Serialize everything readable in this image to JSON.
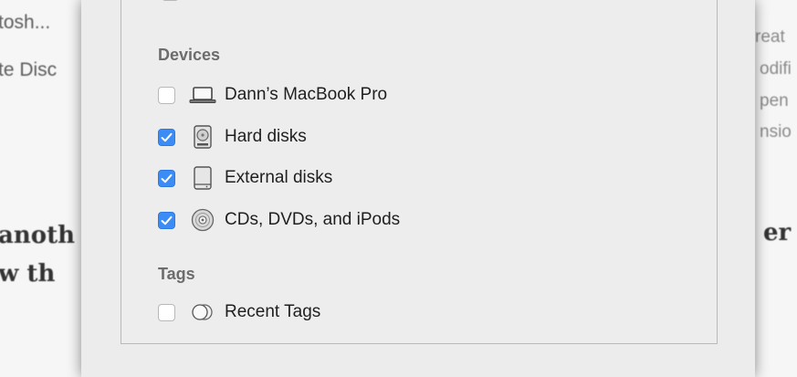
{
  "background": {
    "left_lines": [
      "tosh...",
      "te Disc",
      "anoth",
      "w th"
    ],
    "right_lines": [
      "reat",
      "odifi",
      "pen",
      "nsio",
      "er"
    ]
  },
  "sidebar_prefs": {
    "devices": {
      "title": "Devices",
      "items": [
        {
          "label": "Dann’s MacBook Pro",
          "checked": false,
          "icon": "laptop-icon"
        },
        {
          "label": "Hard disks",
          "checked": true,
          "icon": "hard-disk-icon"
        },
        {
          "label": "External disks",
          "checked": true,
          "icon": "external-disk-icon"
        },
        {
          "label": "CDs, DVDs, and iPods",
          "checked": true,
          "icon": "optical-disc-icon"
        }
      ]
    },
    "tags": {
      "title": "Tags",
      "items": [
        {
          "label": "Recent Tags",
          "checked": false,
          "icon": "tags-icon"
        }
      ]
    }
  },
  "colors": {
    "accent": "#3b8cf5"
  }
}
